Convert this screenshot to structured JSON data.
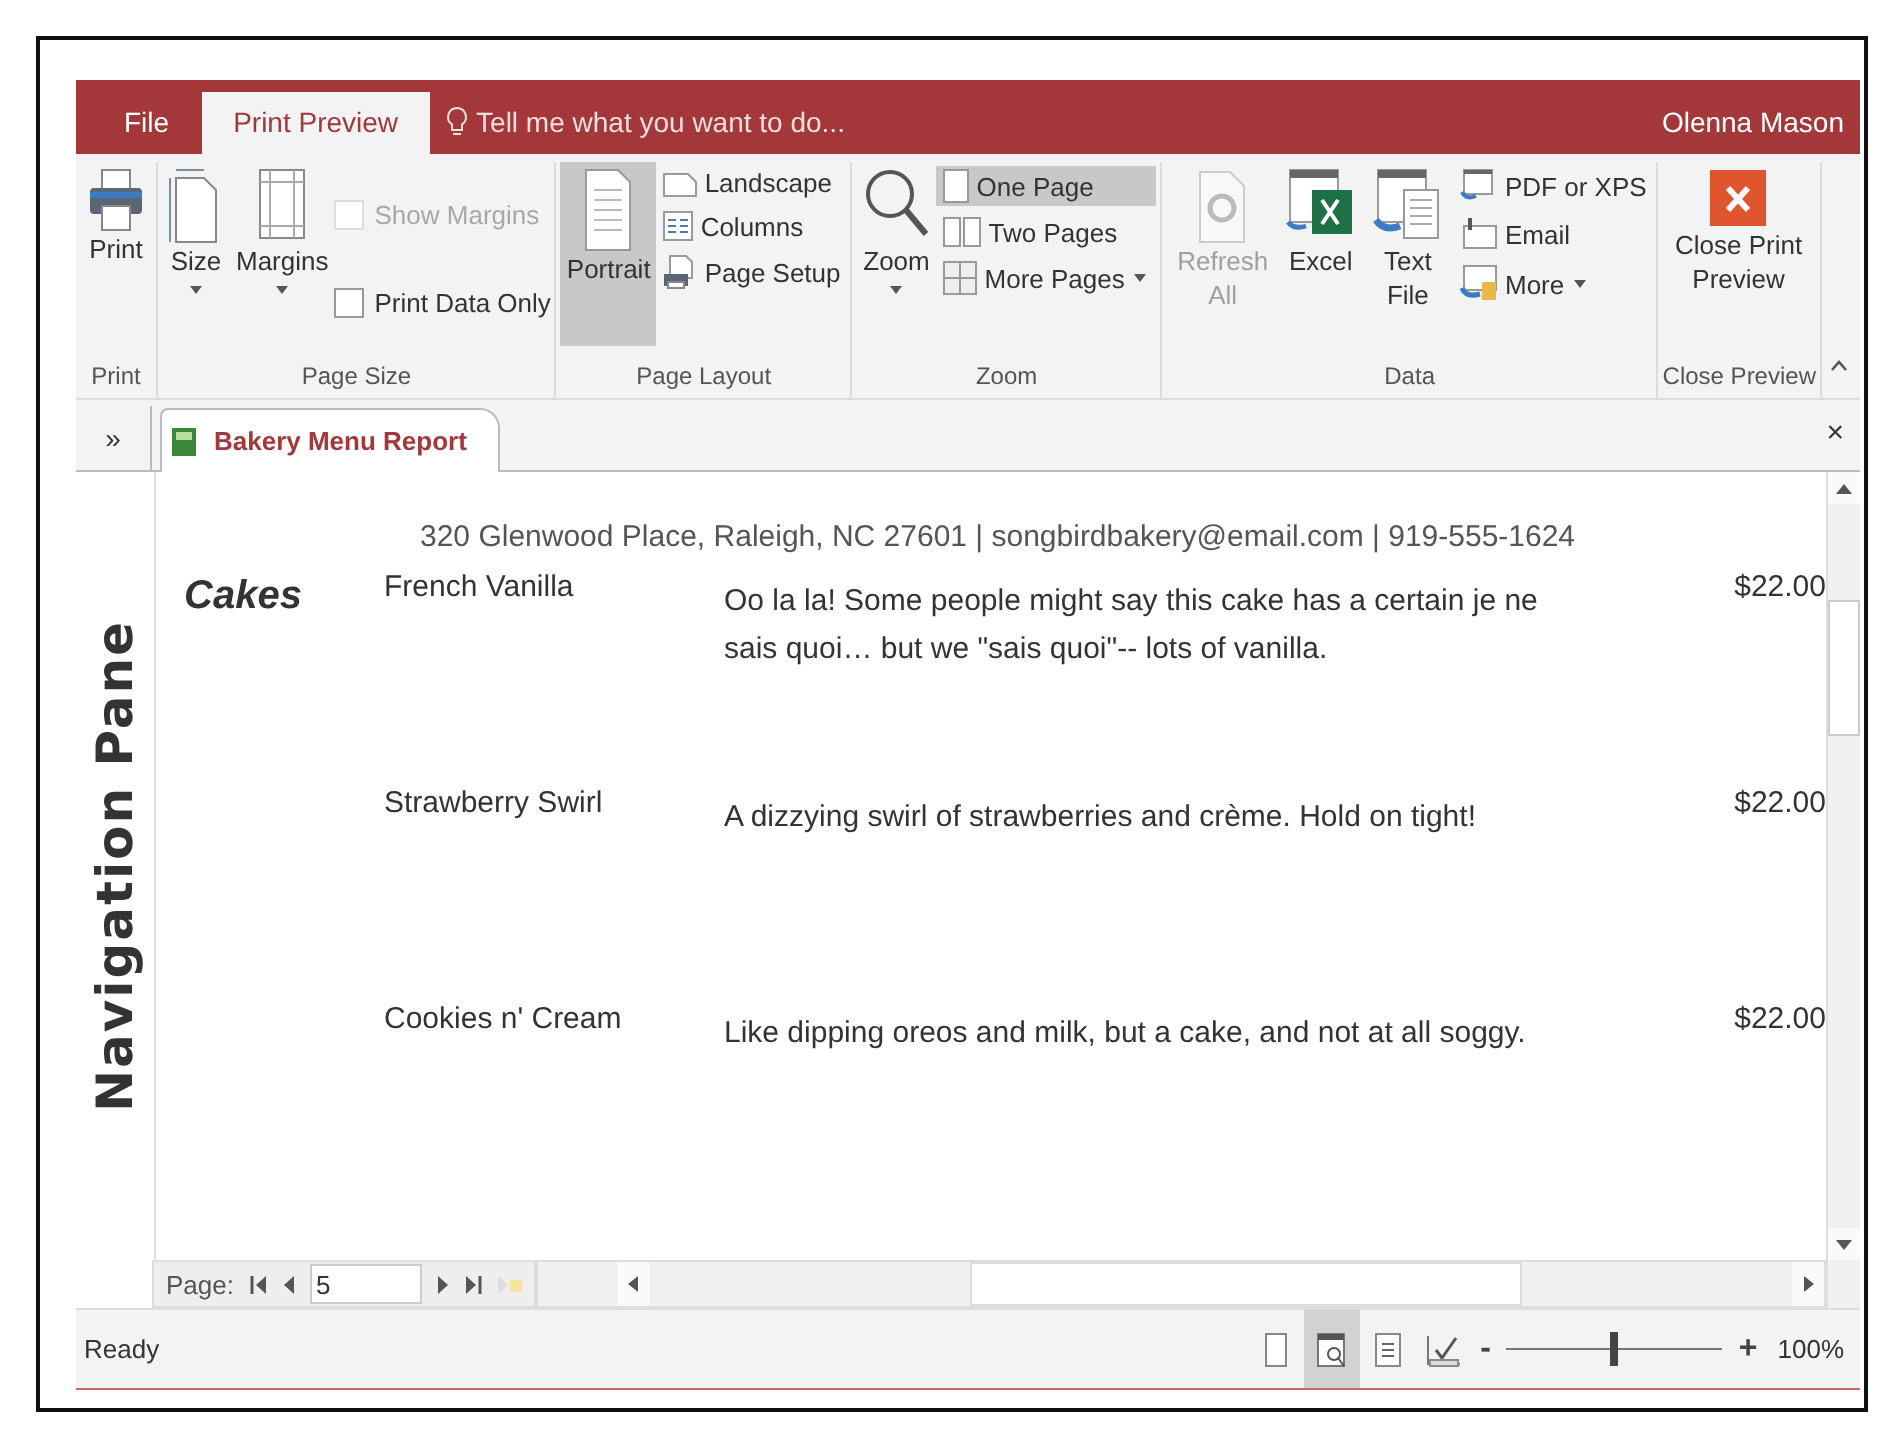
{
  "title_bar": {
    "tabs": [
      {
        "label": "File",
        "selected": false
      },
      {
        "label": "Print Preview",
        "selected": true
      }
    ],
    "tell_me": "Tell me what you want to do...",
    "user": "Olenna Mason"
  },
  "ribbon": {
    "groups": [
      {
        "label": "Print",
        "items": [
          {
            "kind": "large",
            "label": "Print",
            "dropdown": false,
            "selected": false,
            "disabled": false
          }
        ]
      },
      {
        "label": "Page Size",
        "items": [
          {
            "kind": "large",
            "label": "Size",
            "dropdown": true,
            "selected": false,
            "disabled": false
          },
          {
            "kind": "large",
            "label": "Margins",
            "dropdown": true,
            "selected": false,
            "disabled": false
          },
          {
            "kind": "checks",
            "checks": [
              {
                "label": "Show Margins",
                "checked": false,
                "disabled": true
              },
              {
                "label": "Print Data Only",
                "checked": false,
                "disabled": false
              }
            ]
          }
        ]
      },
      {
        "label": "Page Layout",
        "items": [
          {
            "kind": "large",
            "label": "Portrait",
            "dropdown": false,
            "selected": true,
            "disabled": false
          },
          {
            "kind": "stack",
            "rows": [
              {
                "label": "Landscape",
                "selected": false,
                "dropdown": false
              },
              {
                "label": "Columns",
                "selected": false,
                "dropdown": false
              },
              {
                "label": "Page Setup",
                "selected": false,
                "dropdown": false
              }
            ]
          }
        ]
      },
      {
        "label": "Zoom",
        "items": [
          {
            "kind": "large",
            "label": "Zoom",
            "dropdown": true,
            "selected": false,
            "disabled": false
          },
          {
            "kind": "stack",
            "rows": [
              {
                "label": "One Page",
                "selected": true,
                "dropdown": false
              },
              {
                "label": "Two Pages",
                "selected": false,
                "dropdown": false
              },
              {
                "label": "More Pages",
                "selected": false,
                "dropdown": true
              }
            ]
          }
        ]
      },
      {
        "label": "Data",
        "items": [
          {
            "kind": "large",
            "label": "Refresh All",
            "dropdown": false,
            "selected": false,
            "disabled": true
          },
          {
            "kind": "large",
            "label": "Excel",
            "dropdown": false,
            "selected": false,
            "disabled": false
          },
          {
            "kind": "large",
            "label": "Text File",
            "dropdown": false,
            "selected": false,
            "disabled": false
          },
          {
            "kind": "stack",
            "rows": [
              {
                "label": "PDF or XPS",
                "selected": false,
                "dropdown": false
              },
              {
                "label": "Email",
                "selected": false,
                "dropdown": false
              },
              {
                "label": "More",
                "selected": false,
                "dropdown": true
              }
            ]
          }
        ]
      },
      {
        "label": "Close Preview",
        "items": [
          {
            "kind": "large",
            "label": "Close Print Preview",
            "dropdown": false,
            "selected": false,
            "disabled": false
          }
        ]
      }
    ]
  },
  "document_tabs": {
    "chevron": "»",
    "tabs": [
      {
        "label": "Bakery Menu Report",
        "selected": true
      }
    ],
    "close": "×"
  },
  "navigation_pane": {
    "label": "Navigation Pane"
  },
  "report": {
    "address": "320 Glenwood Place, Raleigh, NC 27601 | songbirdbakery@email.com  | 919-555-1624",
    "category": "Cakes",
    "rows": [
      {
        "name": "French Vanilla",
        "description": "Oo la la! Some people might say this cake has a certain je ne sais quoi… but we \"sais quoi\"-- lots of vanilla.",
        "price": "$22.00"
      },
      {
        "name": "Strawberry Swirl",
        "description": "A dizzying swirl of strawberries and crème. Hold on tight!",
        "price": "$22.00"
      },
      {
        "name": "Cookies n' Cream",
        "description": "Like dipping oreos and milk, but a cake, and not at all soggy.",
        "price": "$22.00"
      }
    ]
  },
  "page_navigator": {
    "label": "Page:",
    "value": "5"
  },
  "status_bar": {
    "text": "Ready",
    "views": [
      {
        "kind": "report",
        "selected": false
      },
      {
        "kind": "print-preview",
        "selected": true
      },
      {
        "kind": "layout",
        "selected": false
      },
      {
        "kind": "design",
        "selected": false
      }
    ],
    "zoom": {
      "minus": "-",
      "plus": "+",
      "level": 0.5,
      "reading": "100%"
    }
  }
}
